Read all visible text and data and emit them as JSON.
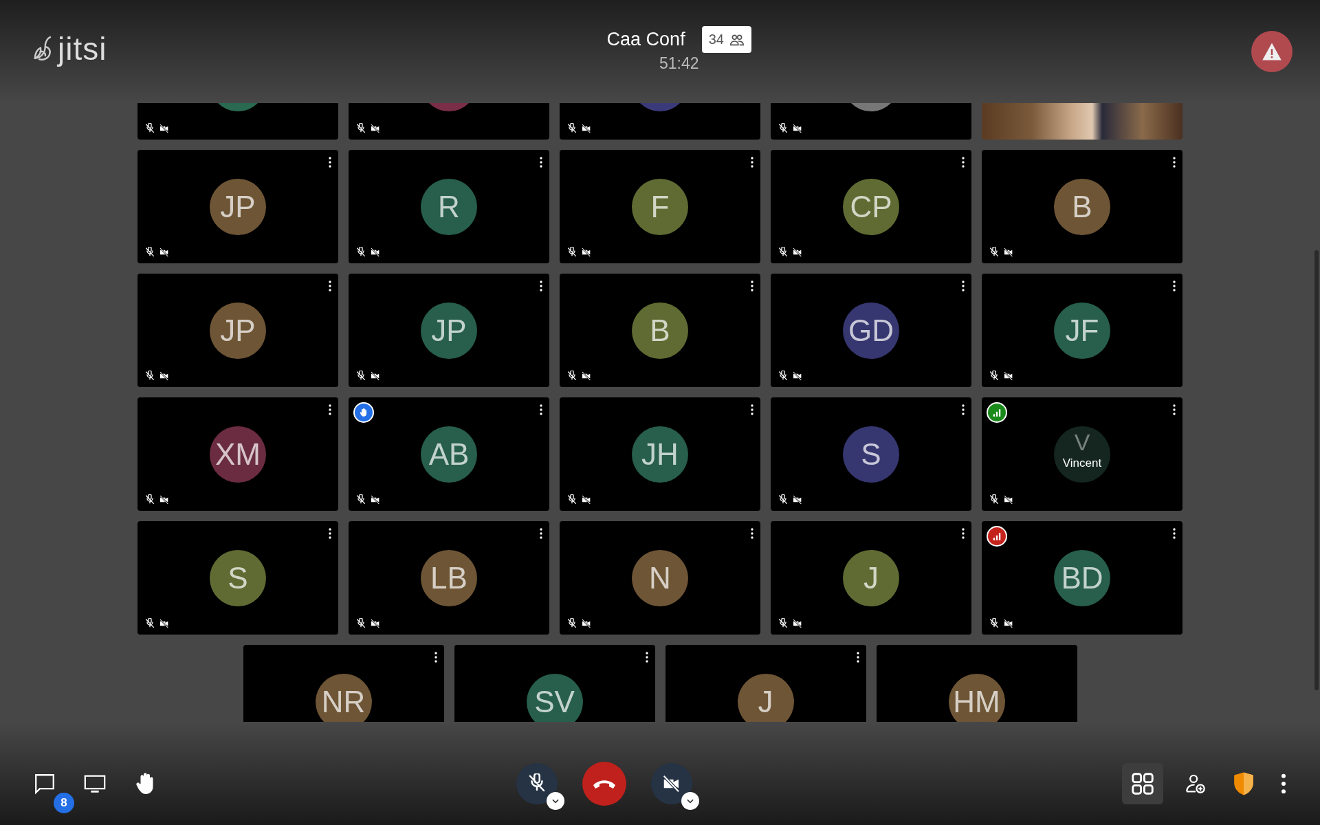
{
  "header": {
    "logo": "jitsi",
    "title": "Caa Conf",
    "participant_count": "34",
    "timer": "51:42"
  },
  "tile_rows": [
    {
      "tiles": [
        {
          "kind": "avatar",
          "color": "#2a6a50",
          "muted": true,
          "camera_off": true
        },
        {
          "kind": "avatar",
          "color": "#7a2e48",
          "muted": true,
          "camera_off": true
        },
        {
          "kind": "avatar",
          "color": "#3a3a7a",
          "muted": true,
          "camera_off": true
        },
        {
          "kind": "avatar",
          "color": "#777777",
          "muted": true,
          "camera_off": true
        },
        {
          "kind": "video"
        }
      ]
    },
    {
      "tiles": [
        {
          "kind": "avatar",
          "initials": "JP",
          "color": "#6e5535",
          "menu": true,
          "muted": true,
          "camera_off": true
        },
        {
          "kind": "avatar",
          "initials": "R",
          "color": "#275e4c",
          "menu": true,
          "muted": true,
          "camera_off": true
        },
        {
          "kind": "avatar",
          "initials": "F",
          "color": "#5f6b32",
          "menu": true,
          "muted": true,
          "camera_off": true
        },
        {
          "kind": "avatar",
          "initials": "CP",
          "color": "#5f6b32",
          "menu": true,
          "muted": true,
          "camera_off": true
        },
        {
          "kind": "avatar",
          "initials": "B",
          "color": "#6e5535",
          "menu": true,
          "muted": true,
          "camera_off": true
        }
      ]
    },
    {
      "tiles": [
        {
          "kind": "avatar",
          "initials": "JP",
          "color": "#6e5535",
          "menu": true,
          "muted": true,
          "camera_off": true
        },
        {
          "kind": "avatar",
          "initials": "JP",
          "color": "#275e4c",
          "menu": true,
          "muted": true,
          "camera_off": true
        },
        {
          "kind": "avatar",
          "initials": "B",
          "color": "#5f6b32",
          "menu": true,
          "muted": true,
          "camera_off": true
        },
        {
          "kind": "avatar",
          "initials": "GD",
          "color": "#363670",
          "menu": true,
          "muted": true,
          "camera_off": true
        },
        {
          "kind": "avatar",
          "initials": "JF",
          "color": "#275e4c",
          "menu": true,
          "muted": true,
          "camera_off": true
        }
      ]
    },
    {
      "tiles": [
        {
          "kind": "avatar",
          "initials": "XM",
          "color": "#6b2c42",
          "menu": true,
          "muted": true,
          "camera_off": true
        },
        {
          "kind": "avatar",
          "initials": "AB",
          "color": "#275e4c",
          "menu": true,
          "muted": true,
          "camera_off": true,
          "hand_raised": true
        },
        {
          "kind": "avatar",
          "initials": "JH",
          "color": "#275e4c",
          "menu": true,
          "muted": true,
          "camera_off": true
        },
        {
          "kind": "avatar",
          "initials": "S",
          "color": "#363670",
          "menu": true,
          "muted": true,
          "camera_off": true
        },
        {
          "kind": "avatar",
          "initials": "V",
          "color": "#14261f",
          "menu": true,
          "muted": true,
          "camera_off": true,
          "connection": {
            "color": "#1a8a1a"
          },
          "name": "Vincent"
        }
      ]
    },
    {
      "tiles": [
        {
          "kind": "avatar",
          "initials": "S",
          "color": "#5f6b32",
          "menu": true,
          "muted": true,
          "camera_off": true
        },
        {
          "kind": "avatar",
          "initials": "LB",
          "color": "#6e5535",
          "menu": true,
          "muted": true,
          "camera_off": true
        },
        {
          "kind": "avatar",
          "initials": "N",
          "color": "#6e5535",
          "menu": true,
          "muted": true,
          "camera_off": true
        },
        {
          "kind": "avatar",
          "initials": "J",
          "color": "#5f6b32",
          "menu": true,
          "muted": true,
          "camera_off": true
        },
        {
          "kind": "avatar",
          "initials": "BD",
          "color": "#275e4c",
          "menu": true,
          "muted": true,
          "camera_off": true,
          "connection": {
            "color": "#c4231c"
          }
        }
      ]
    },
    {
      "tiles": [
        {
          "kind": "avatar",
          "initials": "NR",
          "color": "#6e5535",
          "menu": true
        },
        {
          "kind": "avatar",
          "initials": "SV",
          "color": "#275e4c",
          "menu": true
        },
        {
          "kind": "avatar",
          "initials": "J",
          "color": "#6e5535",
          "menu": true
        },
        {
          "kind": "avatar",
          "initials": "HM",
          "color": "#6e5535",
          "menu": false
        }
      ]
    }
  ],
  "toolbar": {
    "chat_unread": "8",
    "tile_view_selected": true,
    "mic_muted": true,
    "camera_off": true
  }
}
